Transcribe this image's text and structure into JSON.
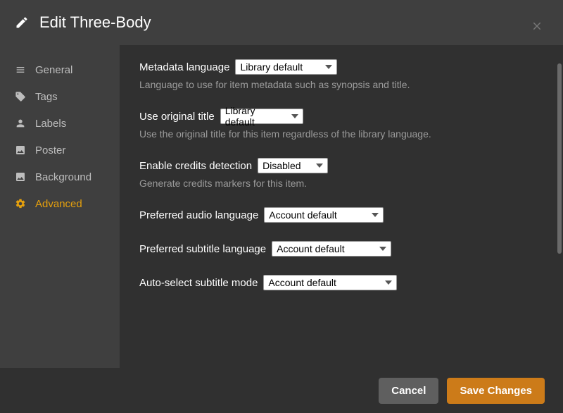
{
  "header": {
    "title": "Edit Three-Body"
  },
  "sidebar": {
    "items": [
      {
        "label": "General"
      },
      {
        "label": "Tags"
      },
      {
        "label": "Labels"
      },
      {
        "label": "Poster"
      },
      {
        "label": "Background"
      },
      {
        "label": "Advanced"
      }
    ]
  },
  "main": {
    "metadata_language": {
      "label": "Metadata language",
      "value": "Library default",
      "description": "Language to use for item metadata such as synopsis and title."
    },
    "use_original_title": {
      "label": "Use original title",
      "value": "Library default",
      "description": "Use the original title for this item regardless of the library language."
    },
    "credits_detection": {
      "label": "Enable credits detection",
      "value": "Disabled",
      "description": "Generate credits markers for this item."
    },
    "preferred_audio": {
      "label": "Preferred audio language",
      "value": "Account default"
    },
    "preferred_subtitle": {
      "label": "Preferred subtitle language",
      "value": "Account default"
    },
    "auto_subtitle_mode": {
      "label": "Auto-select subtitle mode",
      "value": "Account default"
    }
  },
  "footer": {
    "cancel": "Cancel",
    "save": "Save Changes"
  }
}
